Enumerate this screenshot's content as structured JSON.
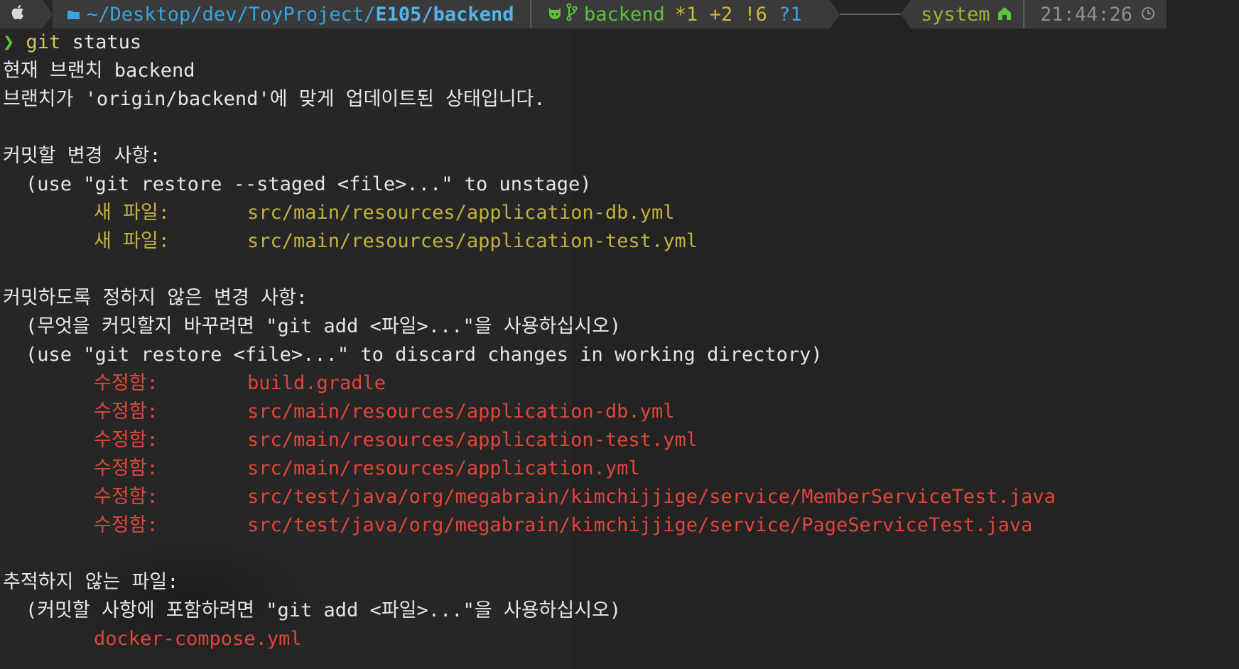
{
  "prompt": {
    "dir_prefix": "~/Desktop/dev/ToyProject/",
    "dir_bold": "E105/backend",
    "git_branch": "backend",
    "git_staged": "*1",
    "git_added": "+2",
    "git_modified": "!6",
    "git_untracked": "?1",
    "env": "system",
    "time": "21:44:26"
  },
  "command": {
    "symbol": "❯",
    "name": "git",
    "arg": "status"
  },
  "output": {
    "branch_line": "현재 브랜치 backend",
    "uptodate_line": "브랜치가 'origin/backend'에 맞게 업데이트된 상태입니다.",
    "staged_header": "커밋할 변경 사항:",
    "staged_hint": "(use \"git restore --staged <file>...\" to unstage)",
    "staged_files": [
      {
        "label": "새 파일:",
        "path": "src/main/resources/application-db.yml"
      },
      {
        "label": "새 파일:",
        "path": "src/main/resources/application-test.yml"
      }
    ],
    "unstaged_header": "커밋하도록 정하지 않은 변경 사항:",
    "unstaged_hint1": "(무엇을 커밋할지 바꾸려면 \"git add <파일>...\"을 사용하십시오)",
    "unstaged_hint2": "(use \"git restore <file>...\" to discard changes in working directory)",
    "unstaged_files": [
      {
        "label": "수정함:",
        "path": "build.gradle"
      },
      {
        "label": "수정함:",
        "path": "src/main/resources/application-db.yml"
      },
      {
        "label": "수정함:",
        "path": "src/main/resources/application-test.yml"
      },
      {
        "label": "수정함:",
        "path": "src/main/resources/application.yml"
      },
      {
        "label": "수정함:",
        "path": "src/test/java/org/megabrain/kimchijjige/service/MemberServiceTest.java"
      },
      {
        "label": "수정함:",
        "path": "src/test/java/org/megabrain/kimchijjige/service/PageServiceTest.java"
      }
    ],
    "untracked_header": "추적하지 않는 파일:",
    "untracked_hint": "(커밋할 사항에 포함하려면 \"git add <파일>...\"을 사용하십시오)",
    "untracked_files": [
      "docker-compose.yml"
    ]
  },
  "icons": {
    "os": "apple-icon",
    "folder": "folder-icon",
    "github": "github-icon",
    "branch": "git-branch-icon",
    "env": "home-icon",
    "clock": "clock-icon"
  },
  "colors": {
    "background": "#262626",
    "segment": "#3a3a3a",
    "dir": "#36a6e0",
    "git": "#5fc33a",
    "staged": "#c2b23d",
    "unstaged": "#e0463a",
    "time": "#8f8f8f"
  }
}
